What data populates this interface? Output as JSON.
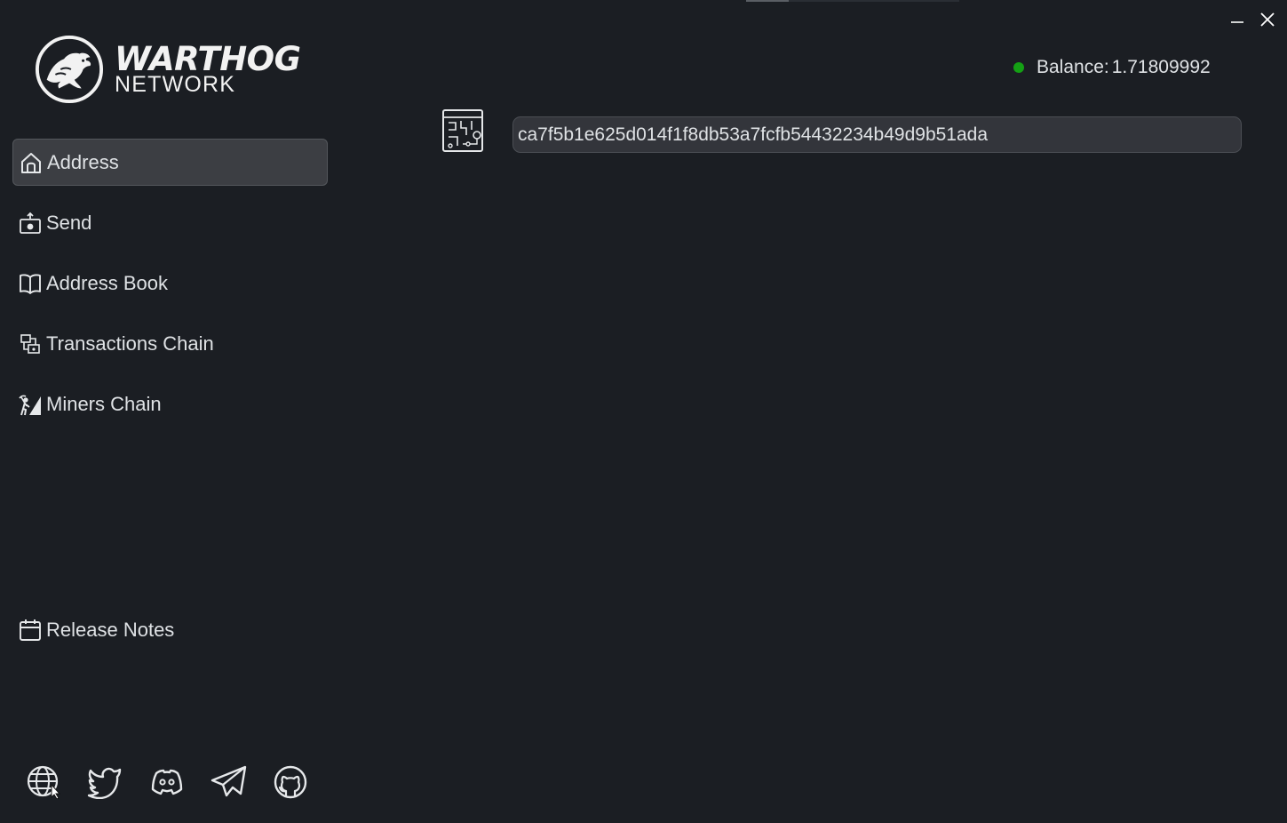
{
  "window": {
    "minimize_label": "minimize",
    "close_label": "close"
  },
  "logo": {
    "line1": "WARTHOG",
    "line2": "NETWORK"
  },
  "sidebar": {
    "items": [
      {
        "label": "Address",
        "icon": "home-icon",
        "active": true
      },
      {
        "label": "Send",
        "icon": "send-money-icon",
        "active": false
      },
      {
        "label": "Address Book",
        "icon": "book-icon",
        "active": false
      },
      {
        "label": "Transactions Chain",
        "icon": "transactions-chain-icon",
        "active": false
      },
      {
        "label": "Miners Chain",
        "icon": "miner-icon",
        "active": false
      }
    ],
    "release_notes": {
      "label": "Release Notes",
      "icon": "calendar-icon"
    }
  },
  "header": {
    "balance_label": "Balance:",
    "balance_value": "1.71809992",
    "status_color": "#14a014"
  },
  "main": {
    "address_icon": "circuit-chip-icon",
    "address_value": "ca7f5b1e625d014f1f8db53a7fcfb54432234b49d9b51ada"
  },
  "social": [
    {
      "icon": "globe-icon"
    },
    {
      "icon": "twitter-icon"
    },
    {
      "icon": "discord-icon"
    },
    {
      "icon": "telegram-icon"
    },
    {
      "icon": "github-icon"
    }
  ],
  "colors": {
    "background": "#1b1e23",
    "active_item": "#3c3e43",
    "field_bg": "#33353b",
    "text": "#dfe2e5"
  }
}
